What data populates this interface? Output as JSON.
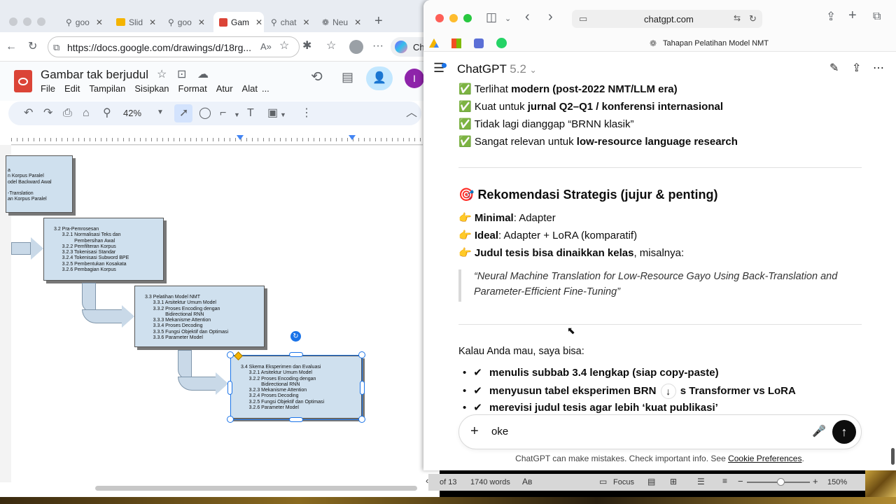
{
  "left_browser": {
    "tabs": [
      {
        "label": "goo",
        "icon": "search-icon"
      },
      {
        "label": "Slid",
        "icon": "slides-icon"
      },
      {
        "label": "goo",
        "icon": "search-icon"
      },
      {
        "label": "Gam",
        "icon": "drawings-icon"
      },
      {
        "label": "chat",
        "icon": "search-icon"
      },
      {
        "label": "Neu",
        "icon": "openai-icon"
      }
    ],
    "url": "https://docs.google.com/drawings/d/18rg...",
    "profile_label": "Ch",
    "doc_title": "Gambar tak berjudul",
    "menu": [
      "File",
      "Edit",
      "Tampilan",
      "Sisipkan",
      "Format",
      "Atur",
      "Alat",
      "..."
    ],
    "zoom": "42%",
    "share_avatar": "I",
    "diagram": {
      "box1": "a\nn Korpus Paralel\nodel Backward Awal\n\n-Translation\nan Korpus Paralel",
      "box2": "3.2 Pra-Pemrosesan\n      3.2.1 Normalisasi Teks dan\n               Pembersihan Awal\n      3.2.2 Pemfilteran Korpus\n      3.2.3 Tokenisasi Standar\n      3.2.4 Tokenisasi Subword BPE\n      3.2.5 Pembentukan Kosakata\n      3.2.6 Pembagian Korpus",
      "box3": "3.3 Pelatihan Model NMT\n      3.3.1 Arsitektur Umum Model\n      3.3.2 Proses Encoding dengan\n               Bidirectional RNN\n      3.3.3 Mekanisme Attention\n      3.3.4 Proses Decoding\n      3.3.5 Fungsi Objektif dan Optimasi\n      3.3.6 Parameter Model",
      "box4": "3.4 Skema Eksperimen dan Evaluasi\n      3.2.1 Arsitektur Umum Model\n      3.2.2 Proses Encoding dengan\n               Bidirectional RNN\n      3.2.3 Mekanisme Attention\n      3.2.4 Proses Decoding\n      3.2.5 Fungsi Objektif dan Optimasi\n      3.2.6 Parameter Model"
    }
  },
  "right_window": {
    "url": "chatgpt.com",
    "page_tab_title": "Tahapan Pelatihan Model NMT",
    "model_name": "ChatGPT",
    "model_version": "5.2",
    "lines_top": [
      {
        "pre": "Terlihat ",
        "bold": "modern (post-2022 NMT/LLM era)",
        "post": ""
      },
      {
        "pre": "Kuat untuk ",
        "bold": "jurnal Q2–Q1 / konferensi internasional",
        "post": ""
      },
      {
        "pre": "Tidak lagi dianggap “BRNN klasik”",
        "bold": "",
        "post": ""
      },
      {
        "pre": "Sangat relevan untuk ",
        "bold": "low-resource language research",
        "post": ""
      }
    ],
    "check_emoji": "✅",
    "heading_emoji": "🎯",
    "heading": "Rekomendasi Strategis (jujur & penting)",
    "point_emoji": "👉",
    "recs": [
      {
        "bold": "Minimal",
        "rest": ": Adapter"
      },
      {
        "bold": "Ideal",
        "rest": ": Adapter + LoRA (komparatif)"
      },
      {
        "bold": "Judul tesis bisa dinaikkan kelas",
        "rest": ", misalnya:"
      }
    ],
    "quote_line1": "“Neural Machine Translation for Low-Resource Gayo Using Back-Translation and",
    "quote_line2": "Parameter-Efficient Fine-Tuning”",
    "offer_intro": "Kalau Anda mau, saya bisa:",
    "offers": [
      "menulis subbab 3.4 lengkap (siap copy-paste)",
      "menyusun tabel eksperimen BRN",
      "merevisi judul tesis agar lebih ‘kuat publikasi’"
    ],
    "offer2_tail": "s Transformer vs LoRA",
    "tick": "✔",
    "composer_text": "oke",
    "footer_text": "ChatGPT can make mistakes. Check important info. See",
    "footer_link": "Cookie Preferences",
    "footer_end": "."
  },
  "bottom_status": {
    "page": "of 13",
    "words": "1740 words",
    "focus": "Focus",
    "zoom": "150%"
  }
}
